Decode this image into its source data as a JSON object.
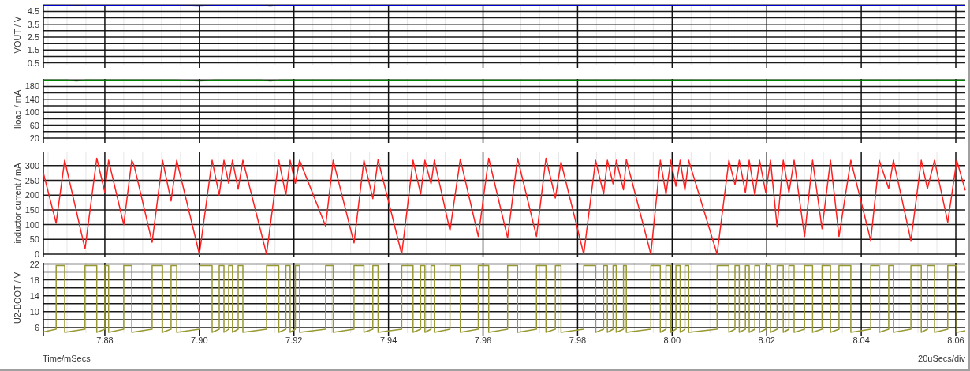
{
  "panels": [
    {
      "chart_data": {
        "type": "line",
        "ylabel": "VOUT / V",
        "grid": true,
        "xlim": [
          7.867,
          8.062
        ],
        "ylim": [
          0.35,
          5.02
        ],
        "yticks": [
          {
            "value": 0.5,
            "label": "0.5"
          },
          {
            "value": 1.5,
            "label": "1.5"
          },
          {
            "value": 2.5,
            "label": "2.5"
          },
          {
            "value": 3.5,
            "label": "3.5"
          },
          {
            "value": 4.5,
            "label": "4.5"
          }
        ],
        "x": [
          7.867,
          7.872,
          7.874,
          7.876,
          7.88,
          7.895,
          7.9,
          7.903,
          7.913,
          7.915,
          7.917,
          7.94,
          8.062
        ],
        "series": [
          {
            "color": "#0000cc",
            "values": [
              4.98,
              4.98,
              4.94,
              4.98,
              4.98,
              4.98,
              4.93,
              4.98,
              4.98,
              4.93,
              4.98,
              4.98,
              4.98
            ]
          }
        ]
      }
    },
    {
      "chart_data": {
        "type": "line",
        "ylabel": "Iload / mA",
        "grid": true,
        "xlim": [
          7.867,
          8.062
        ],
        "ylim": [
          15,
          203
        ],
        "yticks": [
          {
            "value": 20,
            "label": "20"
          },
          {
            "value": 60,
            "label": "60"
          },
          {
            "value": 100,
            "label": "100"
          },
          {
            "value": 140,
            "label": "140"
          },
          {
            "value": 180,
            "label": "180"
          }
        ],
        "x": [
          7.867,
          7.872,
          7.874,
          7.876,
          7.88,
          7.895,
          7.9,
          7.903,
          7.913,
          7.915,
          7.917,
          7.94,
          8.062
        ],
        "series": [
          {
            "color": "#008000",
            "values": [
              199,
              199,
              197,
              199,
              199,
              199,
              197,
              199,
              199,
              197,
              199,
              199,
              199
            ]
          }
        ]
      }
    },
    {
      "chart_data": {
        "type": "line",
        "ylabel": "inductor current / mA",
        "grid": true,
        "xlim": [
          7.867,
          8.062
        ],
        "ylim": [
          0,
          345
        ],
        "yticks": [
          {
            "value": 0,
            "label": "0"
          },
          {
            "value": 50,
            "label": "50"
          },
          {
            "value": 100,
            "label": "100"
          },
          {
            "value": 150,
            "label": "150"
          },
          {
            "value": 200,
            "label": "200"
          },
          {
            "value": 250,
            "label": "250"
          },
          {
            "value": 300,
            "label": "300"
          }
        ],
        "x": [
          7.867,
          7.8697,
          7.8715,
          7.8758,
          7.8783,
          7.88,
          7.8808,
          7.884,
          7.8857,
          7.8862,
          7.89,
          7.8922,
          7.894,
          7.8952,
          7.9,
          7.9027,
          7.9042,
          7.9052,
          7.9062,
          7.907,
          7.9082,
          7.9092,
          7.9142,
          7.9168,
          7.9183,
          7.9192,
          7.9203,
          7.9212,
          7.9267,
          7.9283,
          7.9327,
          7.9348,
          7.9367,
          7.9378,
          7.9428,
          7.9452,
          7.9468,
          7.9477,
          7.949,
          7.9497,
          7.953,
          7.9552,
          7.959,
          7.9612,
          7.9652,
          7.9673,
          7.9713,
          7.9733,
          7.9753,
          7.9765,
          7.9813,
          7.9838,
          7.9855,
          7.9863,
          7.9875,
          7.9882,
          7.9897,
          7.9903,
          7.9955,
          7.9975,
          7.9987,
          7.9997,
          8.0008,
          8.0017,
          8.0027,
          8.0035,
          8.0095,
          8.012,
          8.0133,
          8.0142,
          8.0155,
          8.0163,
          8.0175,
          8.0185,
          8.0198,
          8.0208,
          8.0222,
          8.0235,
          8.0247,
          8.0258,
          8.028,
          8.0297,
          8.0317,
          8.0335,
          8.0353,
          8.0378,
          8.042,
          8.0438,
          8.0458,
          8.0468,
          8.0505,
          8.0527,
          8.054,
          8.0555,
          8.0583,
          8.0602,
          8.062
        ],
        "series": [
          {
            "color": "#ff2020",
            "values": [
              275,
              105,
              318,
              18,
              325,
              210,
              318,
              100,
              318,
              300,
              40,
              318,
              180,
              318,
              0,
              318,
              200,
              318,
              240,
              318,
              220,
              318,
              0,
              318,
              200,
              318,
              240,
              318,
              95,
              318,
              38,
              318,
              188,
              320,
              0,
              318,
              203,
              318,
              238,
              318,
              80,
              322,
              60,
              325,
              55,
              325,
              60,
              325,
              190,
              312,
              0,
              318,
              203,
              318,
              238,
              318,
              218,
              320,
              0,
              318,
              203,
              318,
              230,
              318,
              216,
              318,
              0,
              318,
              235,
              318,
              208,
              318,
              200,
              318,
              208,
              318,
              92,
              318,
              208,
              318,
              60,
              318,
              86,
              318,
              60,
              318,
              46,
              318,
              222,
              318,
              46,
              318,
              222,
              318,
              108,
              318,
              216
            ]
          }
        ]
      }
    },
    {
      "chart_data": {
        "type": "line",
        "ylabel": "U2-BOOT / V",
        "xlabel": "Time/mSecs",
        "grid": true,
        "xlim": [
          7.867,
          8.062
        ],
        "ylim": [
          4.6,
          22.3
        ],
        "xticks": [
          {
            "value": 7.88,
            "label": "7.88"
          },
          {
            "value": 7.9,
            "label": "7.90"
          },
          {
            "value": 7.92,
            "label": "7.92"
          },
          {
            "value": 7.94,
            "label": "7.94"
          },
          {
            "value": 7.96,
            "label": "7.96"
          },
          {
            "value": 7.98,
            "label": "7.98"
          },
          {
            "value": 8.0,
            "label": "8.00"
          },
          {
            "value": 8.02,
            "label": "8.02"
          },
          {
            "value": 8.04,
            "label": "8.04"
          },
          {
            "value": 8.06,
            "label": "8.06"
          }
        ],
        "yticks": [
          {
            "value": 6,
            "label": "6"
          },
          {
            "value": 10,
            "label": "10"
          },
          {
            "value": 14,
            "label": "14"
          },
          {
            "value": 18,
            "label": "18"
          },
          {
            "value": 22,
            "label": "22"
          }
        ],
        "x": [
          7.867,
          7.8697,
          7.8697,
          7.8715,
          7.8715,
          7.8758,
          7.8758,
          7.8783,
          7.8783,
          7.88,
          7.88,
          7.8808,
          7.8808,
          7.884,
          7.884,
          7.8857,
          7.8857,
          7.89,
          7.89,
          7.8922,
          7.8922,
          7.894,
          7.894,
          7.8952,
          7.8952,
          7.9,
          7.9,
          7.9027,
          7.9027,
          7.9042,
          7.9042,
          7.9052,
          7.9052,
          7.9062,
          7.9062,
          7.907,
          7.907,
          7.9082,
          7.9082,
          7.9092,
          7.9092,
          7.9142,
          7.9142,
          7.9168,
          7.9168,
          7.9183,
          7.9183,
          7.9192,
          7.9192,
          7.9203,
          7.9203,
          7.9212,
          7.9212,
          7.9267,
          7.9267,
          7.9283,
          7.9283,
          7.9327,
          7.9327,
          7.9348,
          7.9348,
          7.9367,
          7.9367,
          7.9378,
          7.9378,
          7.9428,
          7.9428,
          7.9452,
          7.9452,
          7.9468,
          7.9468,
          7.9477,
          7.9477,
          7.949,
          7.949,
          7.9497,
          7.9497,
          7.953,
          7.953,
          7.9552,
          7.9552,
          7.959,
          7.959,
          7.9612,
          7.9612,
          7.9652,
          7.9652,
          7.9673,
          7.9673,
          7.9713,
          7.9713,
          7.9733,
          7.9733,
          7.9753,
          7.9753,
          7.9765,
          7.9765,
          7.9813,
          7.9813,
          7.9838,
          7.9838,
          7.9855,
          7.9855,
          7.9863,
          7.9863,
          7.9875,
          7.9875,
          7.9882,
          7.9882,
          7.9897,
          7.9897,
          7.9903,
          7.9903,
          7.9955,
          7.9955,
          7.9975,
          7.9975,
          7.9987,
          7.9987,
          7.9997,
          7.9997,
          8.0008,
          8.0008,
          8.0017,
          8.0017,
          8.0027,
          8.0027,
          8.0035,
          8.0035,
          8.0095,
          8.0095,
          8.012,
          8.012,
          8.0133,
          8.0133,
          8.0142,
          8.0142,
          8.0155,
          8.0155,
          8.0163,
          8.0163,
          8.0175,
          8.0175,
          8.0185,
          8.0185,
          8.0198,
          8.0198,
          8.0208,
          8.0208,
          8.0222,
          8.0222,
          8.0235,
          8.0235,
          8.0247,
          8.0247,
          8.0258,
          8.0258,
          8.028,
          8.028,
          8.0297,
          8.0297,
          8.0317,
          8.0317,
          8.0335,
          8.0335,
          8.0353,
          8.0353,
          8.0378,
          8.0378,
          8.042,
          8.042,
          8.0438,
          8.0438,
          8.0458,
          8.0458,
          8.0468,
          8.0468,
          8.0505,
          8.0505,
          8.0527,
          8.0527,
          8.054,
          8.054,
          8.0555,
          8.0555,
          8.0583,
          8.0583,
          8.0602,
          8.0602,
          8.062
        ],
        "series": [
          {
            "color": "#999933",
            "values": [
              4.9,
              5.6,
              21.6,
              21.6,
              4.8,
              5.6,
              21.6,
              21.6,
              4.8,
              5.6,
              21.6,
              21.6,
              4.8,
              5.6,
              21.6,
              21.6,
              4.8,
              5.6,
              21.6,
              21.6,
              4.8,
              5.6,
              21.6,
              21.6,
              4.8,
              5.6,
              21.6,
              21.6,
              4.8,
              5.6,
              21.6,
              21.6,
              4.8,
              5.6,
              21.6,
              21.6,
              4.8,
              5.6,
              21.6,
              21.6,
              4.8,
              5.6,
              21.6,
              21.6,
              4.8,
              5.6,
              21.6,
              21.6,
              4.8,
              5.6,
              21.6,
              21.6,
              4.8,
              5.6,
              21.6,
              21.6,
              4.8,
              5.6,
              21.6,
              21.6,
              4.8,
              5.6,
              21.6,
              21.6,
              4.8,
              5.6,
              21.6,
              21.6,
              4.8,
              5.6,
              21.6,
              21.6,
              4.8,
              5.6,
              21.6,
              21.6,
              4.8,
              5.6,
              21.6,
              21.6,
              4.8,
              5.6,
              21.6,
              21.6,
              4.8,
              5.6,
              21.6,
              21.6,
              4.8,
              5.6,
              21.6,
              21.6,
              4.8,
              5.6,
              21.6,
              21.6,
              4.8,
              5.6,
              21.6,
              21.6,
              4.8,
              5.6,
              21.6,
              21.6,
              4.8,
              5.6,
              21.6,
              21.6,
              4.8,
              5.6,
              21.6,
              21.6,
              4.8,
              5.6,
              21.6,
              21.6,
              4.8,
              5.6,
              21.6,
              21.6,
              4.8,
              5.6,
              21.6,
              21.6,
              4.8,
              5.6,
              21.6,
              21.6,
              4.8,
              5.6,
              21.6,
              21.6,
              4.8,
              5.6,
              21.6,
              21.6,
              4.8,
              5.6,
              21.6,
              21.6,
              4.8,
              5.6,
              21.6,
              21.6,
              4.8,
              5.6,
              21.6,
              21.6,
              4.8,
              5.6,
              21.6,
              21.6,
              4.8,
              5.6,
              21.6,
              21.6,
              4.8,
              5.6,
              21.6,
              21.6,
              4.8,
              5.6,
              21.6,
              21.6,
              4.8,
              5.6,
              21.6,
              21.6,
              4.8,
              5.6,
              21.6,
              21.6,
              4.8,
              5.6,
              21.6,
              21.6,
              4.8,
              5.6,
              21.6,
              21.6,
              4.8,
              5.6,
              21.6,
              21.6,
              4.8,
              5.6,
              21.6,
              21.6,
              4.8,
              5.2
            ]
          }
        ]
      }
    }
  ],
  "footer": {
    "time_scale": "20uSecs/div"
  }
}
